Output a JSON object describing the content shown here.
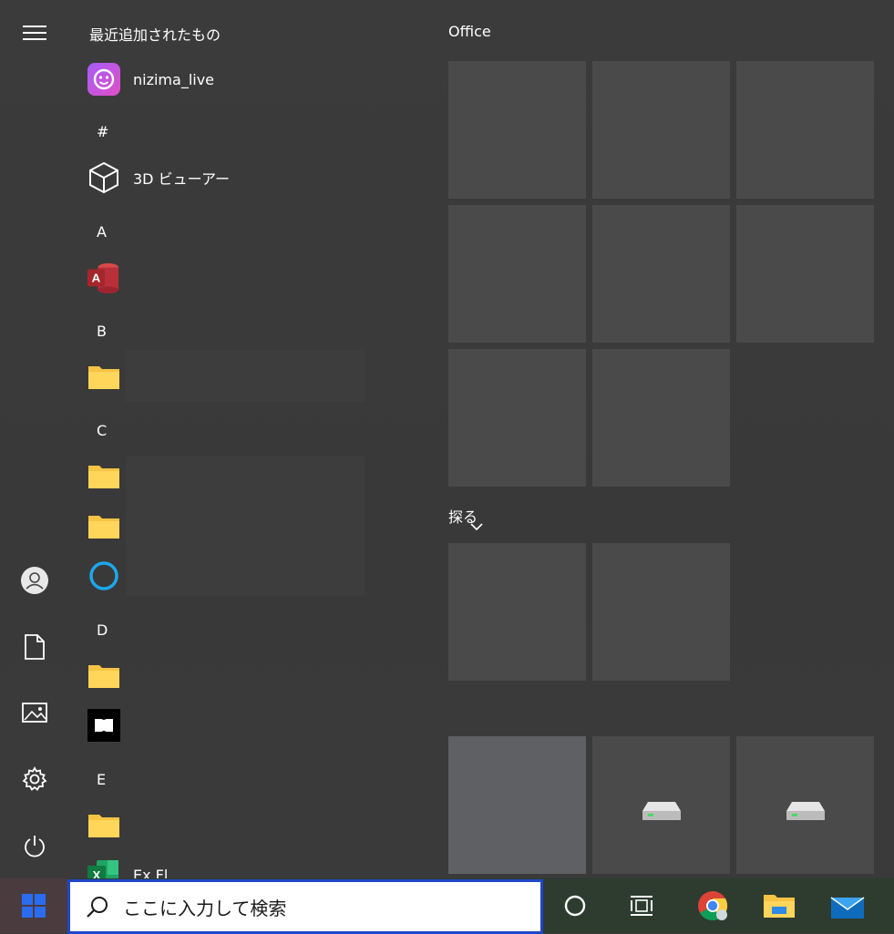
{
  "applist": {
    "recent_header": "最近追加されたもの",
    "apps": {
      "nizima": "nizima_live",
      "viewer3d": "3D ビューアー",
      "excel_partial": "Ex Fl"
    },
    "letters": [
      "#",
      "A",
      "B",
      "C",
      "D",
      "E"
    ]
  },
  "tiles": {
    "group1": "Office",
    "group2": "探る"
  },
  "taskbar": {
    "search_placeholder": "ここに入力して検索"
  },
  "colors": {
    "accent": "#1f47c9",
    "windows_logo": "#2a6cf0",
    "folder": "#f6c343"
  }
}
